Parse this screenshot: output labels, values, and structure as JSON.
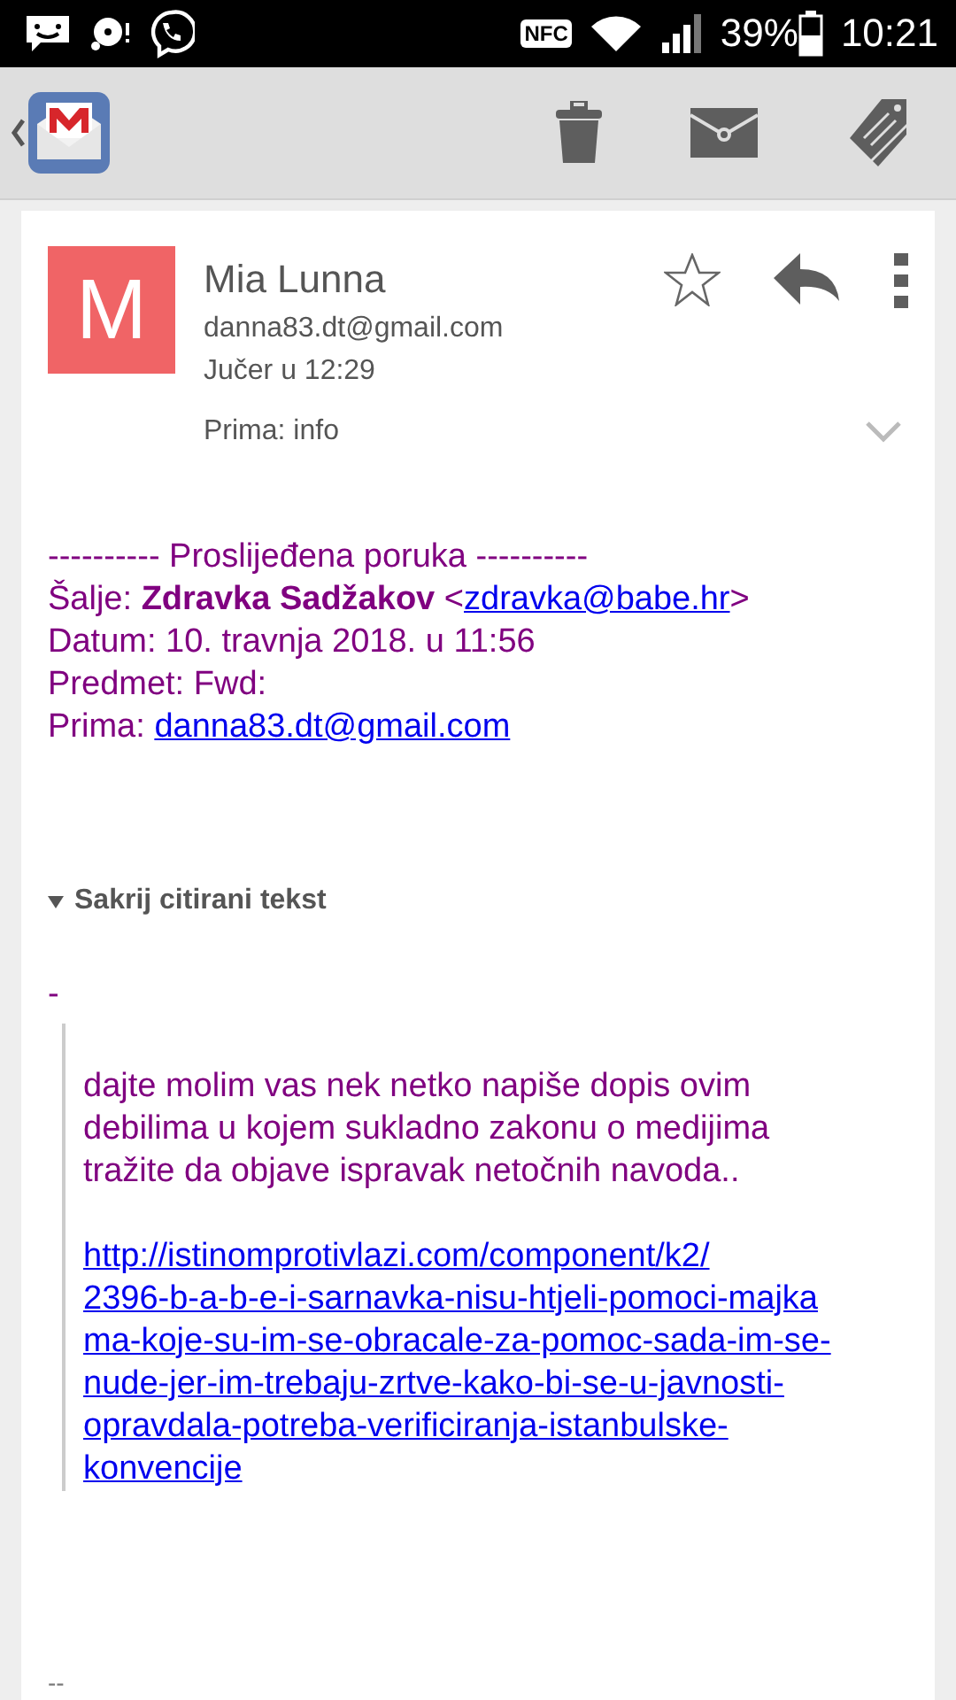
{
  "status_bar": {
    "nfc": "NFC",
    "battery": "39%",
    "time": "10:21"
  },
  "message": {
    "avatar_letter": "M",
    "sender": "Mia Lunna",
    "email": "danna83.dt@gmail.com",
    "date": "Jučer u 12:29",
    "recipients": "Prima: info",
    "starred": false
  },
  "forwarded": {
    "divider": "---------- Proslijeđena poruka ----------",
    "lines": [
      {
        "text": "Šalje: **Zdravka Sadžakov** <",
        "link": "zdravka@babe.hr",
        "after": ">"
      },
      {
        "text": "Datum: 10. travnja 2018. u 11:56"
      },
      {
        "text": "Predmet: Fwd:"
      },
      {
        "text": "Prima: ",
        "link": "danna83.dt@gmail.com"
      }
    ]
  },
  "quote_toggle": {
    "label": "Sakrij citirani tekst",
    "expanded": true
  },
  "dash": "-",
  "quote": {
    "lines": [
      "dajte molim vas nek netko napiše dopis ovim",
      "debilima u kojem sukladno zakonu o medijima",
      "tražite da objave ispravak netočnih navoda.."
    ],
    "url_lines": [
      "http://istinomprotivlazi.com/component/k2/",
      "2396-b-a-b-e-i-sarnavka-nisu-htjeli-pomoci-majka",
      "ma-koje-su-im-se-obracale-za-pomoc-sada-im-se-",
      "nude-jer-im-trebaju-zrtve-kako-bi-se-u-javnosti-",
      "opravdala-potreba-verificiranja-istanbulske-",
      "konvencije"
    ]
  },
  "signature": "--"
}
